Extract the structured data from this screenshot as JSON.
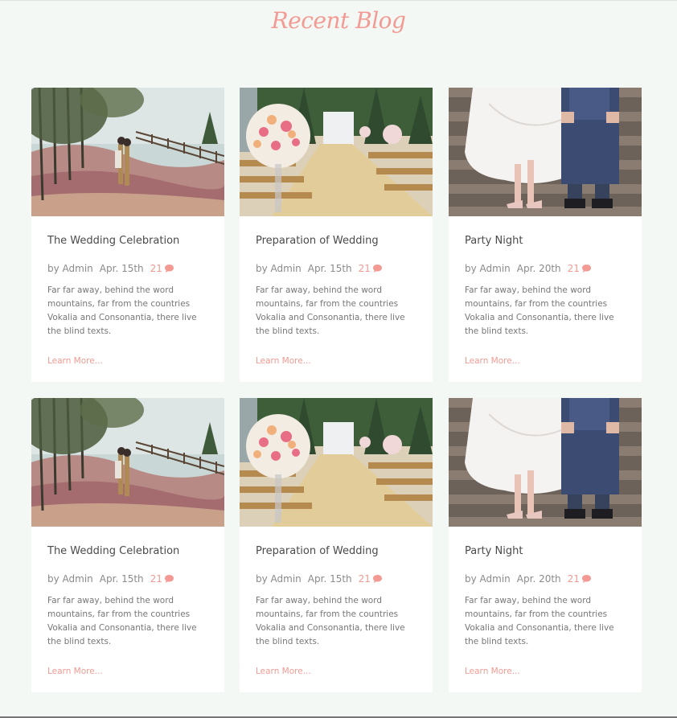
{
  "section": {
    "title": "Recent Blog"
  },
  "accent_color": "#f29a93",
  "posts": [
    {
      "image": "wedding-couple-field-photo",
      "title": "The Wedding Celebration",
      "author": "by Admin",
      "date": "Apr. 15th",
      "comments": "21",
      "excerpt": "Far far away, behind the word mountains, far from the countries Vokalia and Consonantia, there live the blind texts.",
      "link": "Learn More..."
    },
    {
      "image": "wedding-aisle-flowers-photo",
      "title": "Preparation of Wedding",
      "author": "by Admin",
      "date": "Apr. 15th",
      "comments": "21",
      "excerpt": "Far far away, behind the word mountains, far from the countries Vokalia and Consonantia, there live the blind texts.",
      "link": "Learn More..."
    },
    {
      "image": "couple-legs-steps-photo",
      "title": "Party Night",
      "author": "by Admin",
      "date": "Apr. 20th",
      "comments": "21",
      "excerpt": "Far far away, behind the word mountains, far from the countries Vokalia and Consonantia, there live the blind texts.",
      "link": "Learn More..."
    },
    {
      "image": "wedding-couple-field-photo",
      "title": "The Wedding Celebration",
      "author": "by Admin",
      "date": "Apr. 15th",
      "comments": "21",
      "excerpt": "Far far away, behind the word mountains, far from the countries Vokalia and Consonantia, there live the blind texts.",
      "link": "Learn More..."
    },
    {
      "image": "wedding-aisle-flowers-photo",
      "title": "Preparation of Wedding",
      "author": "by Admin",
      "date": "Apr. 15th",
      "comments": "21",
      "excerpt": "Far far away, behind the word mountains, far from the countries Vokalia and Consonantia, there live the blind texts.",
      "link": "Learn More..."
    },
    {
      "image": "couple-legs-steps-photo",
      "title": "Party Night",
      "author": "by Admin",
      "date": "Apr. 20th",
      "comments": "21",
      "excerpt": "Far far away, behind the word mountains, far from the countries Vokalia and Consonantia, there live the blind texts.",
      "link": "Learn More..."
    }
  ]
}
